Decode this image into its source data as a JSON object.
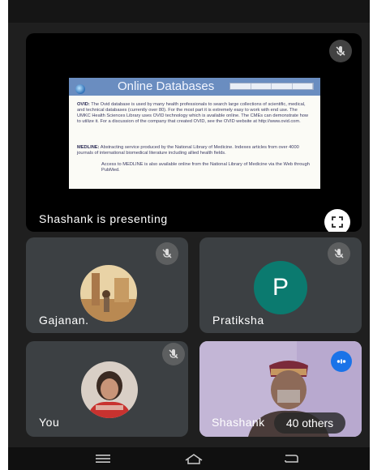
{
  "presentation": {
    "label": "Shashank is presenting",
    "slide": {
      "title": "Online Databases",
      "ovid_heading": "OVID:",
      "ovid_text": "The Ovid database is used by many health professionals to search large collections of scientific, medical, and technical databases (currently over 80). For the most part it is extremely easy to work with end use. The UMKC Health Sciences Library uses OVID technology which is available online. The CMEs can demonstrate how to utilize it. For a discussion of the company that created OVID, see the OVID website at http://www.ovid.com.",
      "medline_heading": "MEDLINE:",
      "medline_text": "Abstracting service produced by the National Library of Medicine. Indexes articles from over 4000 journals of international biomedical literature including allied health fields.",
      "medline_sub": "Access to MEDLINE is also available online from the National Library of Medicine via the Web through PubMed."
    }
  },
  "participants": [
    {
      "name": "Gajanan.",
      "muted": true
    },
    {
      "name": "Pratiksha",
      "initial": "P",
      "muted": true,
      "avatar_color": "#0b7a6f"
    },
    {
      "name": "You",
      "muted": true
    },
    {
      "name": "Shashank",
      "others_label": "40 others"
    }
  ],
  "colors": {
    "background": "#1f1f1f",
    "tile": "#3c4043",
    "accent": "#1a73e8"
  },
  "icons": [
    "mic-off-icon",
    "fullscreen-icon",
    "more-icon",
    "menu-icon",
    "home-icon",
    "back-icon"
  ]
}
